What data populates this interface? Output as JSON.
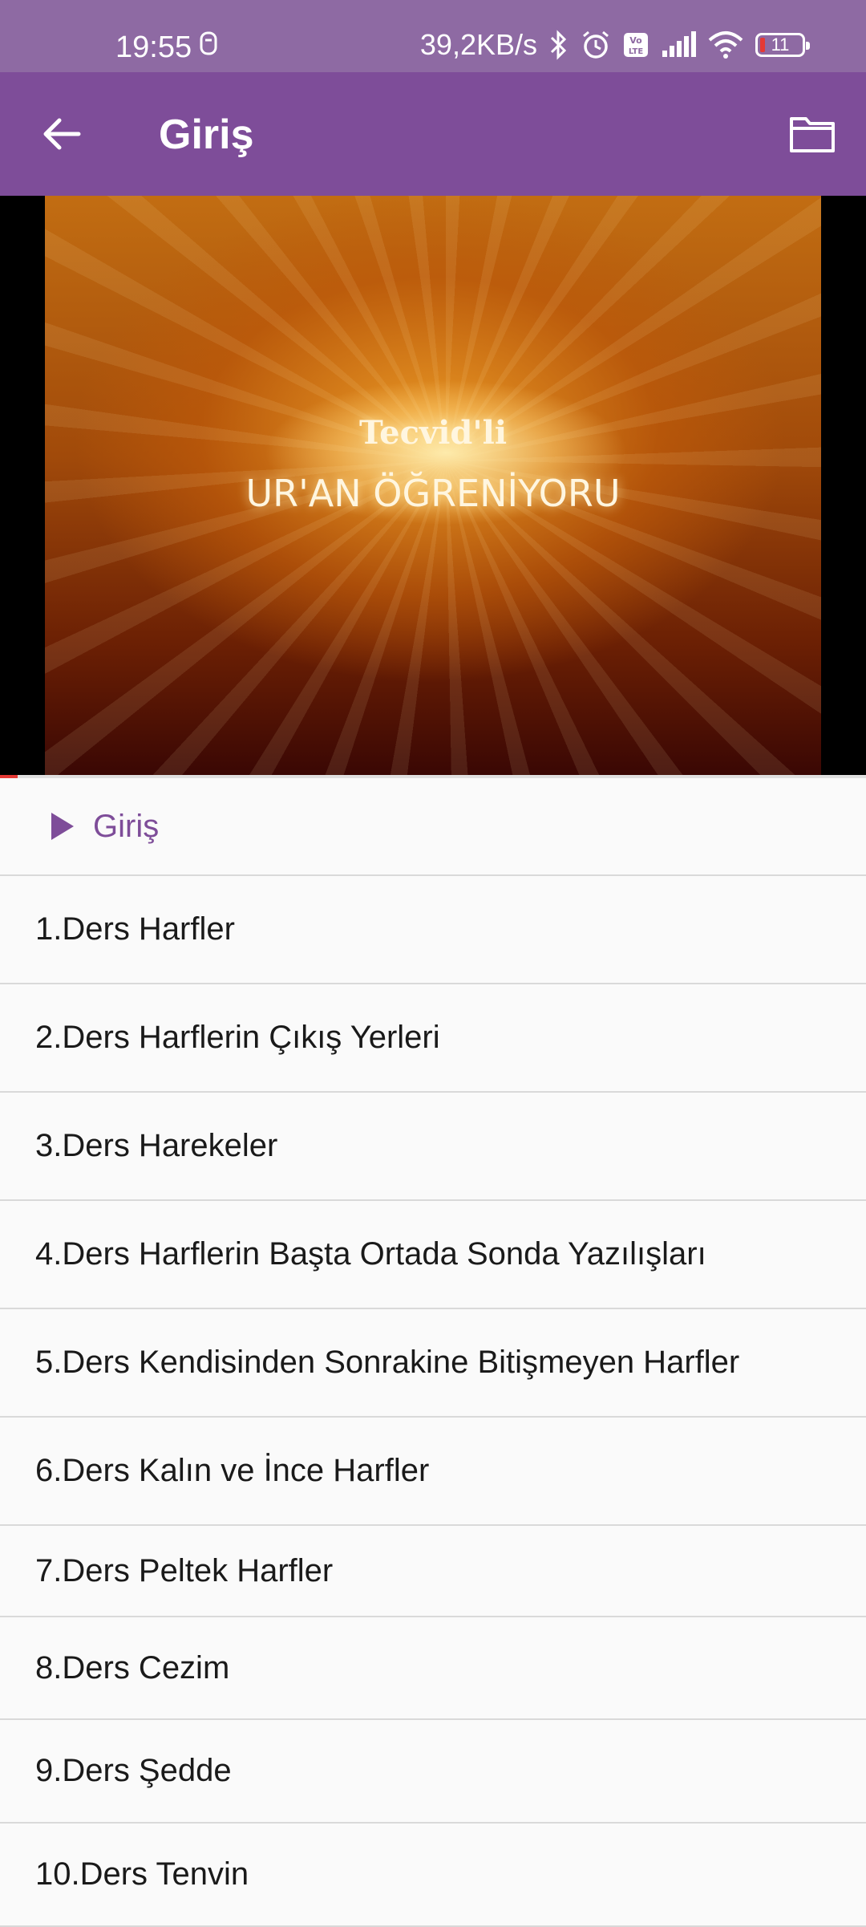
{
  "status_bar": {
    "time": "19:55",
    "speed": "39,2KB/s",
    "battery": "11"
  },
  "app_bar": {
    "title": "Giriş",
    "back_icon": "arrow-left-icon",
    "folder_icon": "folder-icon"
  },
  "video": {
    "overlay_line1": "Tecvid'li",
    "overlay_line2": "UR'AN ÖĞRENİYORU",
    "progress": 0.02
  },
  "lessons": [
    {
      "label": "Giriş",
      "active": true
    },
    {
      "label": "1.Ders Harfler"
    },
    {
      "label": "2.Ders Harflerin Çıkış Yerleri"
    },
    {
      "label": "3.Ders Harekeler"
    },
    {
      "label": "4.Ders Harflerin Başta Ortada Sonda Yazılışları"
    },
    {
      "label": "5.Ders Kendisinden Sonrakine Bitişmeyen Harfler"
    },
    {
      "label": "6.Ders Kalın ve İnce Harfler"
    },
    {
      "label": "7.Ders Peltek Harfler"
    },
    {
      "label": "8.Ders Cezim"
    },
    {
      "label": "9.Ders Şedde"
    },
    {
      "label": "10.Ders Tenvin"
    }
  ],
  "colors": {
    "app_bar": "#7e4d99",
    "status_bar": "#8e6aa3",
    "accent": "#7e4d99"
  }
}
